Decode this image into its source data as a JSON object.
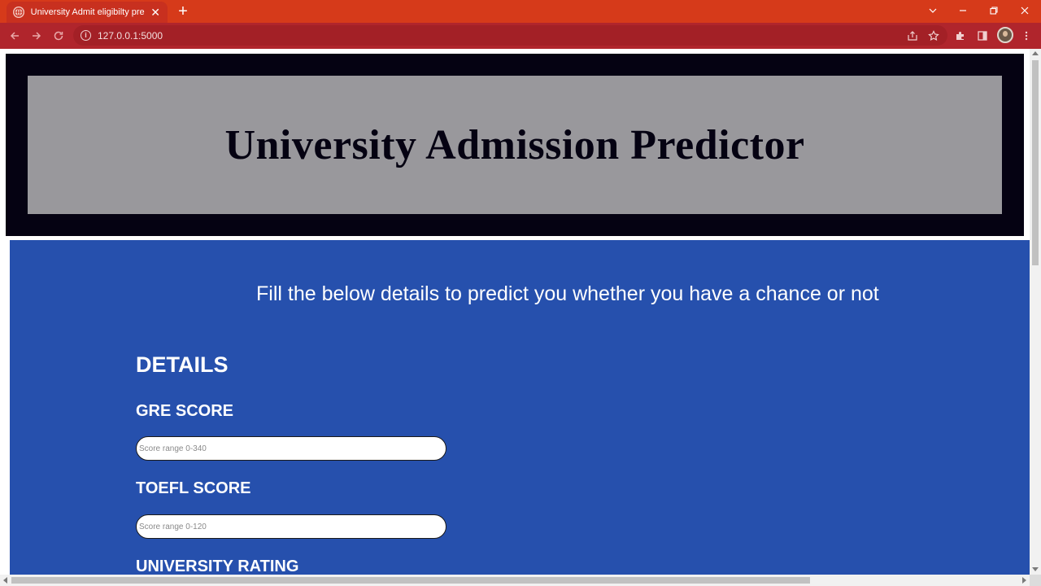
{
  "browser": {
    "tab_title": "University Admit eligibilty predictor",
    "url": "127.0.0.1:5000",
    "colors": {
      "tab_strip": "#d63a1a",
      "toolbar": "#b0252c"
    }
  },
  "page": {
    "title": "University Admission Predictor",
    "intro": "Fill the below details to predict you whether you have a chance or not",
    "section_title": "DETAILS",
    "fields": [
      {
        "label": "GRE SCORE",
        "placeholder": "Score range 0-340",
        "value": ""
      },
      {
        "label": "TOEFL SCORE",
        "placeholder": "Score range 0-120",
        "value": ""
      },
      {
        "label": "UNIVERSITY RATING"
      }
    ],
    "colors": {
      "header_outer": "#050212",
      "header_inner": "#99989c",
      "form_bg": "#2650ad",
      "text": "#ffffff"
    }
  },
  "icons": {
    "tab_favicon": "globe-icon",
    "tab_close": "close-icon",
    "new_tab": "plus-icon",
    "back": "arrow-left-icon",
    "forward": "arrow-right-icon",
    "reload": "reload-icon",
    "site_info": "info-icon",
    "share": "share-icon",
    "bookmark": "star-icon",
    "extensions": "puzzle-icon",
    "side_panel": "side-panel-icon",
    "profile": "avatar",
    "menu": "kebab-menu-icon"
  }
}
